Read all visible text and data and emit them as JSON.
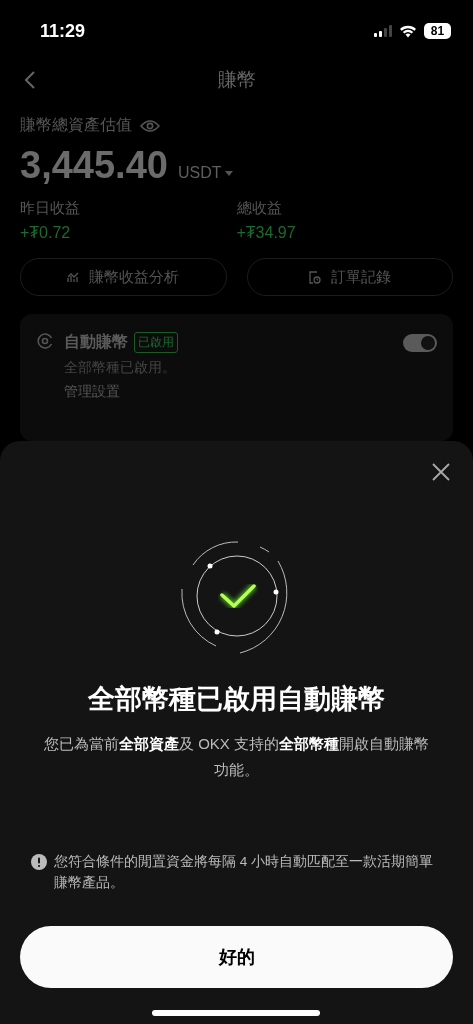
{
  "status_bar": {
    "time": "11:29",
    "battery": "81"
  },
  "header": {
    "title": "賺幣"
  },
  "summary": {
    "label": "賺幣總資產估值",
    "amount": "3,445.40",
    "currency": "USDT",
    "stats": [
      {
        "label": "昨日收益",
        "value": "+₮0.72"
      },
      {
        "label": "總收益",
        "value": "+₮34.97"
      }
    ],
    "buttons": [
      {
        "kind": "chart",
        "label": "賺幣收益分析"
      },
      {
        "kind": "orders",
        "label": "訂單記錄"
      }
    ]
  },
  "auto_earn": {
    "title": "自動賺幣",
    "badge": "已啟用",
    "subtitle": "全部幣種已啟用。",
    "link": "管理設置",
    "on": true
  },
  "sheet": {
    "title": "全部幣種已啟用自動賺幣",
    "description": "您已為當前**全部資產**及 OKX 支持的**全部幣種**開啟自動賺幣功能。",
    "note": "您符合條件的閒置資金將每隔 4 小時自動匹配至一款活期簡單賺幣產品。",
    "button": "好的"
  }
}
